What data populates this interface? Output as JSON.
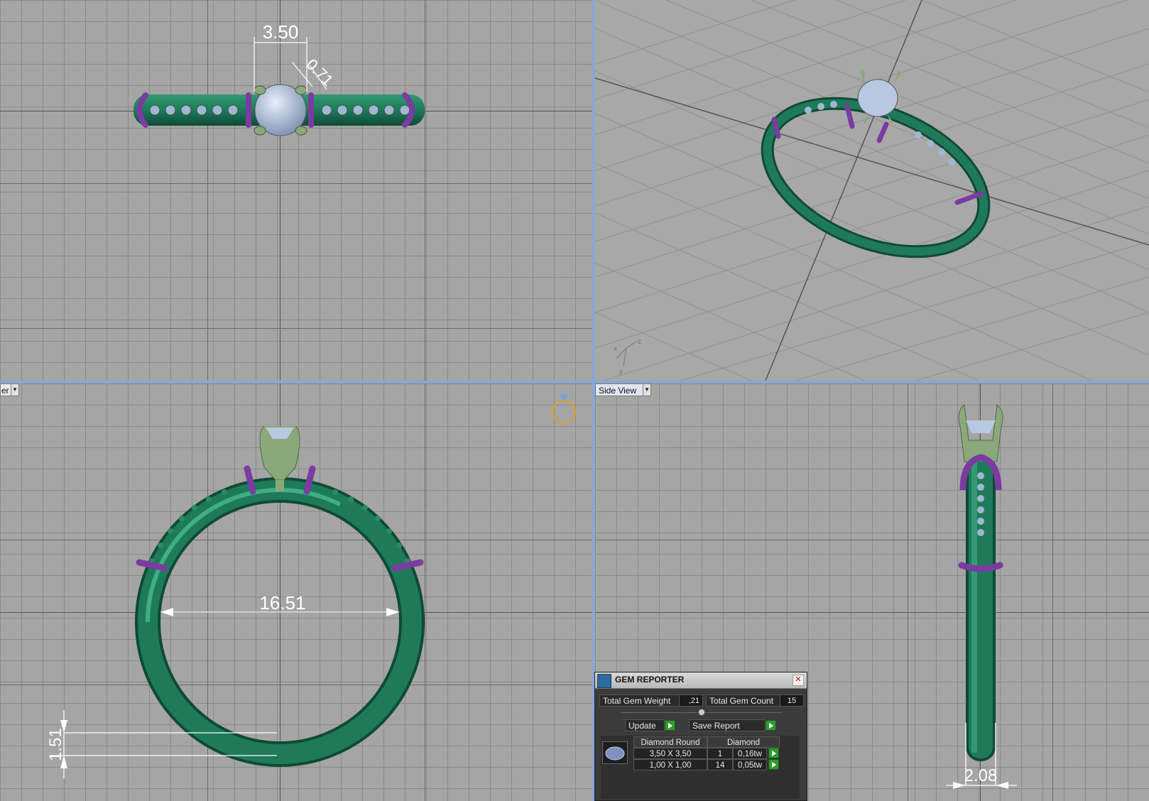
{
  "viewports": {
    "top_left": {
      "dimensions": {
        "width": "3.50",
        "prong": "0.71"
      }
    },
    "top_right": {
      "axes": {
        "x": "x",
        "y": "y",
        "z": "z"
      }
    },
    "bottom_left": {
      "view_label": "er",
      "dimensions": {
        "inner_diameter": "16.51",
        "band_thickness": "1.51"
      }
    },
    "bottom_right": {
      "view_label": "Side View",
      "dimensions": {
        "band_width": "2.08"
      }
    }
  },
  "gem_reporter": {
    "title": "GEM REPORTER",
    "close_glyph": "✕",
    "total_weight_label": "Total Gem Weight",
    "total_weight_value": ",21",
    "total_count_label": "Total Gem Count",
    "total_count_value": "15",
    "update_label": "Update",
    "save_label": "Save Report",
    "table": {
      "headers": [
        "Diamond Round",
        "Diamond"
      ],
      "rows": [
        {
          "size": "3,50 X 3,50",
          "count": "1",
          "weight": "0,16tw"
        },
        {
          "size": "1,00 X 1,00",
          "count": "14",
          "weight": "0,05tw"
        }
      ]
    }
  },
  "colors": {
    "metal": "#1f7a5a",
    "accent": "#7a3ca0",
    "gem": "#b8c8e0",
    "prong": "#8aa87a",
    "grid_bg": "#a5a5a5",
    "divider": "#8aa6d6"
  }
}
